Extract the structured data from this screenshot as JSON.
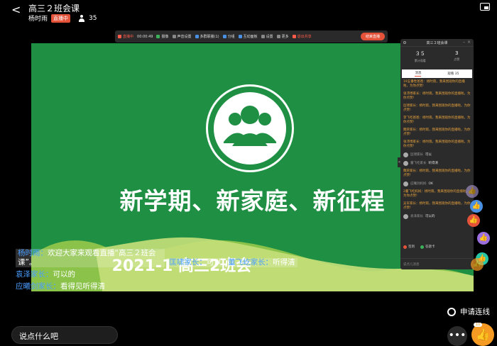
{
  "header": {
    "back_glyph": "<",
    "title": "高三２班会课",
    "host": "杨时雨",
    "live_badge": "直播中",
    "viewer_count": "35"
  },
  "toolbar": {
    "live_label": "直播中",
    "timer": "00:00:49",
    "items": [
      "摄像",
      "声音设置",
      "多群联播(1)",
      "分组",
      "互动面板",
      "设置",
      "更多"
    ],
    "exit_share": "退出共享",
    "end_live": "结束直播"
  },
  "slide": {
    "title": "新学期、新家庭、新征程",
    "subtitle": "2021-1 高三2班会"
  },
  "panel": {
    "title": "高三２班会课",
    "stats": [
      {
        "num": "３５",
        "label": "累计观看"
      },
      {
        "num": "3",
        "label": "点赞"
      }
    ],
    "tabs": [
      "消息",
      "观看 35"
    ],
    "messages": [
      "19五番性爸爸：杨时雨，我来围观你的直播啦，为你点赞!",
      "张沛博家长：杨时雨，我来围观你的直播啦，为你点赞!",
      "匡啸家长：杨时雨，我来围观你的直播啦，为你点赞!",
      "李飞屹爸爸：杨时雨，我来围观你的直播啦，为你点赞!",
      "魏荣家长：杨时雨，我来围观你的直播啦，为你点赞!",
      "张沛博家长：杨时雨，我来围观你的直播啦，为你点赞!"
    ],
    "user_msgs": [
      {
        "who": "匡啸家长",
        "text": "可以"
      },
      {
        "who": "董飞屹家长",
        "text": "听得清"
      }
    ],
    "messages2": [
      "魏荣家长：杨时雨，我来围观你的直播啦，为你点赞!"
    ],
    "user_msgs2": [
      {
        "who": "应曦剑妈妈",
        "text": "OK"
      }
    ],
    "messages3": [
      "2董飞屹妈妈：杨时雨，我来围观你的直播啦，为你点赞!",
      "吴军家长：杨时雨，我来围观你的直播啦，为你点赞!"
    ],
    "user_msgs3": [
      {
        "who": "袁泽家长",
        "text": "可以的"
      }
    ],
    "actions": [
      "签到",
      "答题卡"
    ],
    "input_placeholder": "说点儿消息"
  },
  "comments": [
    {
      "name": "杨时雨：",
      "text": "欢迎大家来观看直播“高三２班会课”。"
    },
    {
      "name": "匡啸家长：",
      "text": "可以"
    },
    {
      "name": "董飞屹家长：",
      "text": "听得清"
    },
    {
      "name": "袁泽家长：",
      "text": "可以的"
    },
    {
      "name": "应曦剑家长：",
      "text": "看得见听得清"
    }
  ],
  "bottom": {
    "say_placeholder": "说点什么吧",
    "apply_link": "申请连线",
    "more_glyph": "•••",
    "like_count": "10"
  },
  "colors": {
    "slide_green": "#1f8f44",
    "slide_light_green": "#8bc34a",
    "live_red": "#e5523a",
    "name_blue": "#4a9eff",
    "like_orange": "#f59a23"
  }
}
